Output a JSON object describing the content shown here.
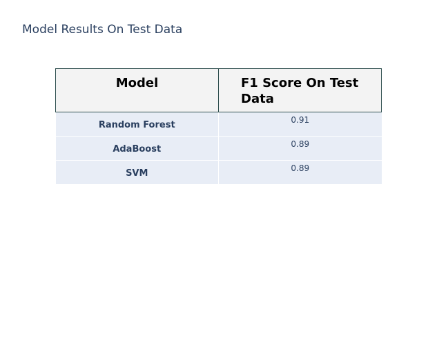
{
  "chart_data": {
    "type": "table",
    "title": "Model Results On Test Data",
    "columns": [
      "Model",
      "F1 Score On Test Data"
    ],
    "rows": [
      {
        "model": "Random Forest",
        "f1": "0.91"
      },
      {
        "model": "AdaBoost",
        "f1": "0.89"
      },
      {
        "model": "SVM",
        "f1": "0.89"
      }
    ]
  },
  "colors": {
    "header_fill": "#f3f3f3",
    "header_border": "#2f4f4f",
    "cell_fill": "#e8edf6",
    "text": "#2a3f5f"
  }
}
